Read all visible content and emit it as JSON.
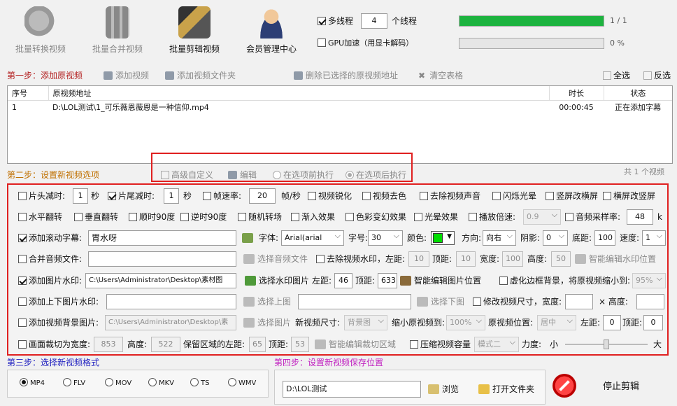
{
  "toolbar": {
    "batch_convert": "批量转换视频",
    "batch_merge": "批量合并视频",
    "batch_edit": "批量剪辑视频",
    "member_center": "会员管理中心",
    "multithread_label": "多线程",
    "thread_count": "4",
    "thread_unit": "个线程",
    "gpu_label": "GPU加速（用显卡解码）",
    "progress1_text": "1 / 1",
    "progress1_value": 1.0,
    "progress2_text": "0 %",
    "progress2_value": 0.0
  },
  "step1": {
    "title": "第一步：添加原视频",
    "add_video": "添加视频",
    "add_folder": "添加视频文件夹",
    "delete_selected": "删除已选择的原视频地址",
    "clear_table": "清空表格",
    "select_all": "全选",
    "invert": "反选"
  },
  "table": {
    "headers": [
      "序号",
      "原视频地址",
      "时长",
      "状态"
    ],
    "rows": [
      {
        "index": "1",
        "path": "D:\\LOL测试\\1_可乐薇恩薇恩是一种信仰.mp4",
        "duration": "00:00:45",
        "status": "正在添加字幕"
      }
    ]
  },
  "step2": {
    "title": "第二步：设置新视频选项",
    "advanced_custom": "高级自定义",
    "edit": "编辑",
    "exec_before": "在选项前执行",
    "exec_after": "在选项后执行",
    "count": "共 1 个视频"
  },
  "options": {
    "head_cut": "片头减时:",
    "head_cut_val": "1",
    "sec": "秒",
    "tail_cut": "片尾减时:",
    "tail_cut_val": "1",
    "sec2": "秒",
    "fps": "帧速率:",
    "fps_val": "20",
    "fps_unit": "帧/秒",
    "sharpen": "视频锐化",
    "decolor": "视频去色",
    "remove_audio": "去除视频声音",
    "flash": "闪烁光晕",
    "v2h": "竖屏改横屏",
    "h2v": "横屏改竖屏",
    "hflip": "水平翻转",
    "vflip": "垂直翻转",
    "rot90cw": "顺时90度",
    "rot90ccw": "逆时90度",
    "transition": "随机转场",
    "fadein": "渐入效果",
    "colorfx": "色彩变幻效果",
    "halo": "光晕效果",
    "speed": "播放倍速:",
    "speed_val": "0.9",
    "samplerate": "音频采样率:",
    "samplerate_val": "48",
    "samplerate_unit": "k",
    "scroll_sub": "添加滚动字幕:",
    "scroll_sub_text": "胃水呀",
    "font_label": "字体:",
    "font_val": "Arial(arial",
    "size_label": "字号:",
    "size_val": "30",
    "color_label": "颜色:",
    "color_hex": "#00dd00",
    "dir_label": "方向:",
    "dir_val": "向右",
    "shadow_label": "阴影:",
    "shadow_val": "0",
    "bottom_label": "底距:",
    "bottom_val": "100",
    "speed2_label": "速度:",
    "speed2_val": "1",
    "merge_audio": "合并音频文件:",
    "choose_audio": "选择音频文件",
    "remove_wm": "去除视频水印，左距:",
    "wm_left": "10",
    "wm_top_label": "顶距:",
    "wm_top": "10",
    "wm_w_label": "宽度:",
    "wm_w": "100",
    "wm_h_label": "高度:",
    "wm_h": "50",
    "smart_wm": "智能编辑水印位置",
    "img_wm": "添加图片水印:",
    "img_wm_path": "C:\\Users\\Administrator\\Desktop\\素材图",
    "choose_wm_img": "选择水印图片",
    "img_left_label": "左距:",
    "img_left": "46",
    "img_top_label": "顶距:",
    "img_top": "633",
    "smart_img": "智能编辑图片位置",
    "blur_bg": "虚化边框背景，将原视频缩小到:",
    "blur_val": "95%",
    "updown_wm": "添加上下图片水印:",
    "choose_top": "选择上图",
    "choose_bottom": "选择下图",
    "resize": "修改视频尺寸，宽度:",
    "resize_h": "高度:",
    "bg_img": "添加视频背景图片:",
    "bg_img_path": "C:\\Users\\Administrator\\Desktop\\素",
    "choose_img": "选择图片",
    "new_size_label": "新视频尺寸:",
    "new_size_val": "背景图",
    "shrink_label": "缩小原视频到:",
    "shrink_val": "100%",
    "pos_label": "原视频位置:",
    "pos_val": "居中",
    "bg_left_label": "左距:",
    "bg_left": "0",
    "bg_top_label": "顶距:",
    "bg_top": "0",
    "crop": "画面裁切为宽度:",
    "crop_w": "853",
    "crop_h_label": "高度:",
    "crop_h": "522",
    "crop_left_label": "保留区域的左距:",
    "crop_left": "65",
    "crop_top_label": "顶距:",
    "crop_top": "53",
    "smart_crop": "智能编辑裁切区域",
    "compress": "压缩视频容量",
    "compress_mode": "模式二",
    "force_label": "力度:",
    "small": "小",
    "big": "大",
    "compress_level": 0.5
  },
  "step3": {
    "title": "第三步：选择新视频格式",
    "formats": [
      "MP4",
      "FLV",
      "MOV",
      "MKV",
      "TS",
      "WMV"
    ]
  },
  "step4": {
    "title": "第四步：设置新视频保存位置",
    "path": "D:\\LOL测试",
    "browse": "浏览",
    "open_folder": "打开文件夹",
    "stop": "停止剪辑"
  }
}
